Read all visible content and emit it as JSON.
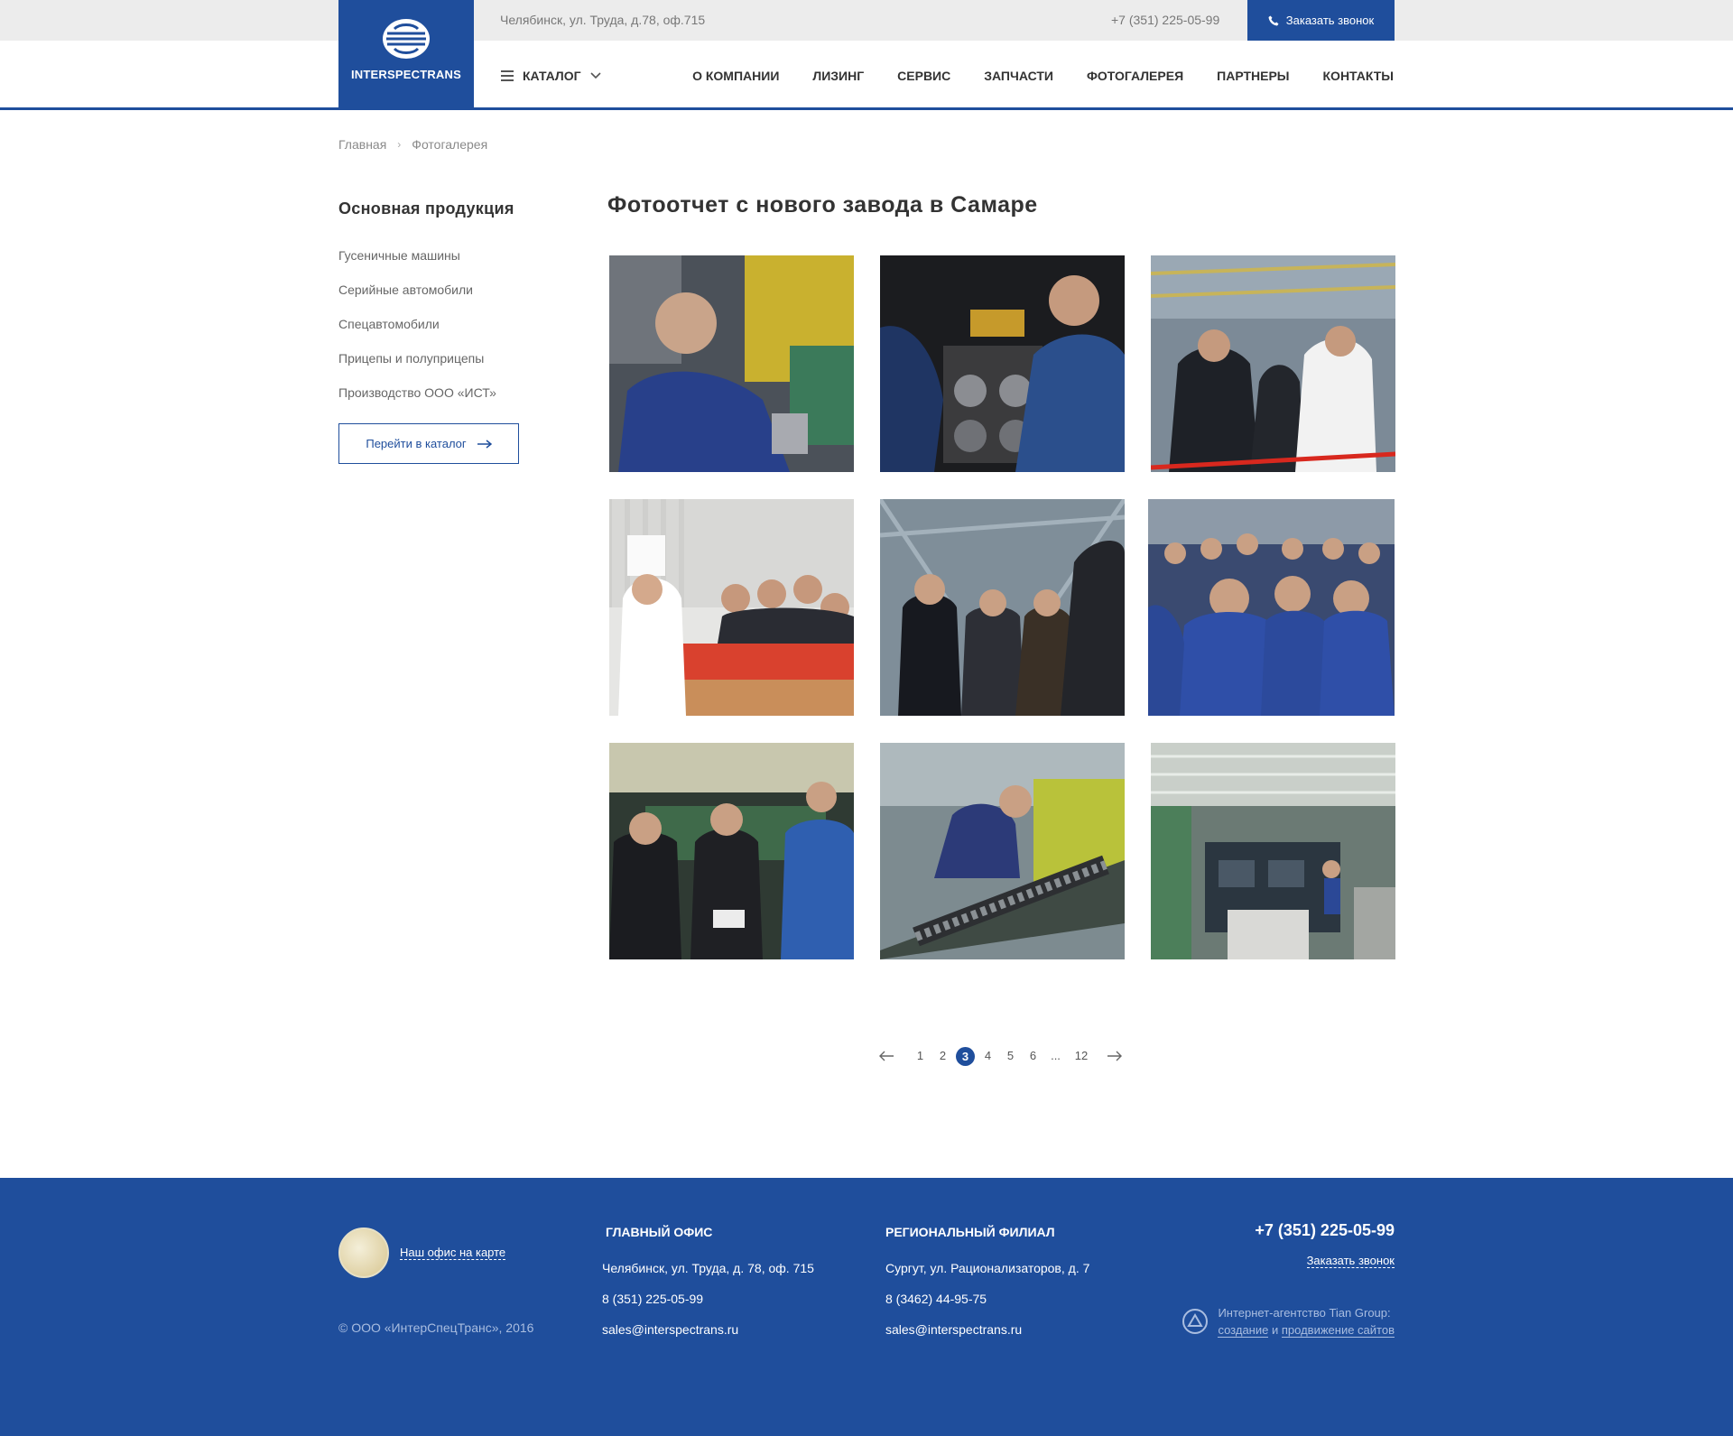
{
  "topbar": {
    "address": "Челябинск, ул. Труда, д.78, оф.715",
    "phone": "+7 (351) 225-05-99",
    "callback": "Заказать звонок"
  },
  "logo": {
    "text": "INTERSPECTRANS"
  },
  "nav": {
    "catalog": "КАТАЛОГ",
    "items": [
      "О КОМПАНИИ",
      "ЛИЗИНГ",
      "СЕРВИС",
      "ЗАПЧАСТИ",
      "ФОТОГАЛЕРЕЯ",
      "ПАРТНЕРЫ",
      "КОНТАКТЫ"
    ]
  },
  "breadcrumb": {
    "home": "Главная",
    "separator": "›",
    "current": "Фотогалерея"
  },
  "sidebar": {
    "title": "Основная продукция",
    "items": [
      "Гусеничные машины",
      "Серийные автомобили",
      "Спецавтомобили",
      "Прицепы и полуприцепы",
      "Производство ООО «ИСТ»"
    ],
    "button": "Перейти в каталог"
  },
  "gallery": {
    "title": "Фотоотчет с нового завода в Самаре"
  },
  "pagination": {
    "pages": [
      "1",
      "2",
      "3",
      "4",
      "5",
      "6",
      "...",
      "12"
    ],
    "active": "3"
  },
  "footer": {
    "map_link": "Наш офис на карте",
    "copyright": "© ООО «ИнтерСпецТранс», 2016",
    "main_office": {
      "title": "ГЛАВНЫЙ ОФИС",
      "address": "Челябинск, ул. Труда, д. 78, оф. 715",
      "phone": "8 (351) 225-05-99",
      "email": "sales@interspectrans.ru"
    },
    "regional": {
      "title": "РЕГИОНАЛЬНЫЙ ФИЛИАЛ",
      "address": "Сургут, ул. Рационализаторов,  д. 7",
      "phone": "8 (3462) 44-95-75",
      "email": "sales@interspectrans.ru"
    },
    "phone": "+7 (351) 225-05-99",
    "callback": "Заказать звонок",
    "agency_line1": "Интернет-агентство Tian Group:",
    "agency_create": "создание",
    "agency_and": "и",
    "agency_promo": "продвижение сайтов"
  },
  "colors": {
    "brand": "#1f4e9c",
    "topbar": "#ececec"
  }
}
